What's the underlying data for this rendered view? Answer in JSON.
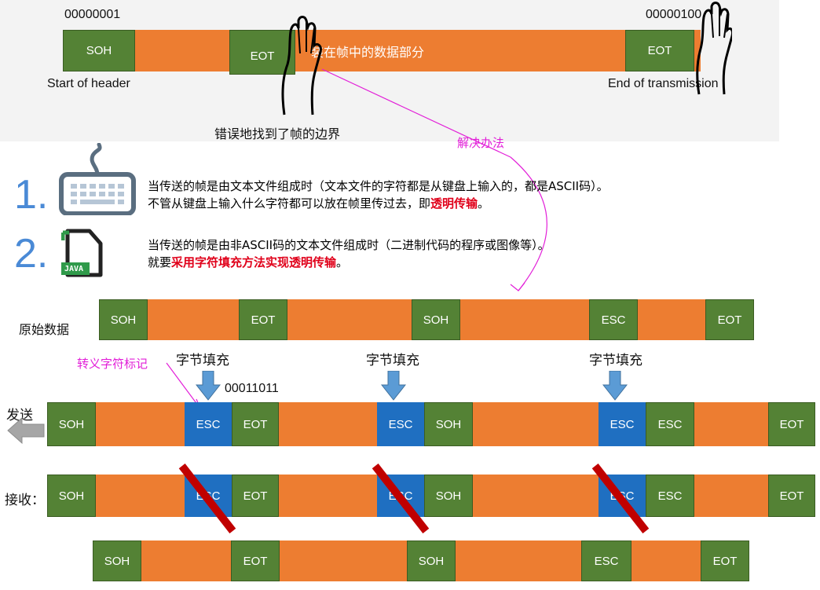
{
  "top_frame": {
    "left_code": "00000001",
    "right_code": "00000100",
    "soh": "SOH",
    "eot_mid": "EOT",
    "eot_end": "EOT",
    "data_text": "装在帧中的数据部分",
    "start_caption": "Start of header",
    "end_caption": "End of transmission",
    "error_caption": "错误地找到了帧的边界",
    "solution_label": "解决办法"
  },
  "point1": {
    "number": "1.",
    "line1": "当传送的帧是由文本文件组成时（文本文件的字符都是从键盘上输入的，都是ASCII码）。",
    "line2_prefix": "不管从键盘上输入什么字符都可以放在帧里传过去，即",
    "line2_emph": "透明传输",
    "line2_suffix": "。"
  },
  "point2": {
    "number": "2.",
    "icon_text": "JAVA",
    "line1": "当传送的帧是由非ASCII码的文本文件组成时（二进制代码的程序或图像等）。",
    "line2_prefix": "就要",
    "line2_emph": "采用字符填充方法实现透明传输",
    "line2_suffix": "。"
  },
  "original": {
    "label": "原始数据",
    "segs": [
      "SOH",
      "EOT",
      "SOH",
      "ESC",
      "EOT"
    ]
  },
  "stuffing": {
    "label": "字节填充",
    "escape_note": "转义字符标记",
    "esc_code": "00011011"
  },
  "send": {
    "label": "发送",
    "segs": [
      "SOH",
      "ESC",
      "EOT",
      "ESC",
      "SOH",
      "ESC",
      "ESC",
      "EOT"
    ]
  },
  "receive": {
    "label": "接收：",
    "segs": [
      "SOH",
      "ESC",
      "EOT",
      "ESC",
      "SOH",
      "ESC",
      "ESC",
      "EOT"
    ]
  },
  "result": {
    "segs": [
      "SOH",
      "EOT",
      "SOH",
      "ESC",
      "EOT"
    ]
  },
  "colors": {
    "green": "#548235",
    "orange": "#ed7d31",
    "blue": "#1f6fc1",
    "red_slash": "#c00000",
    "pink": "#e21fd8"
  }
}
